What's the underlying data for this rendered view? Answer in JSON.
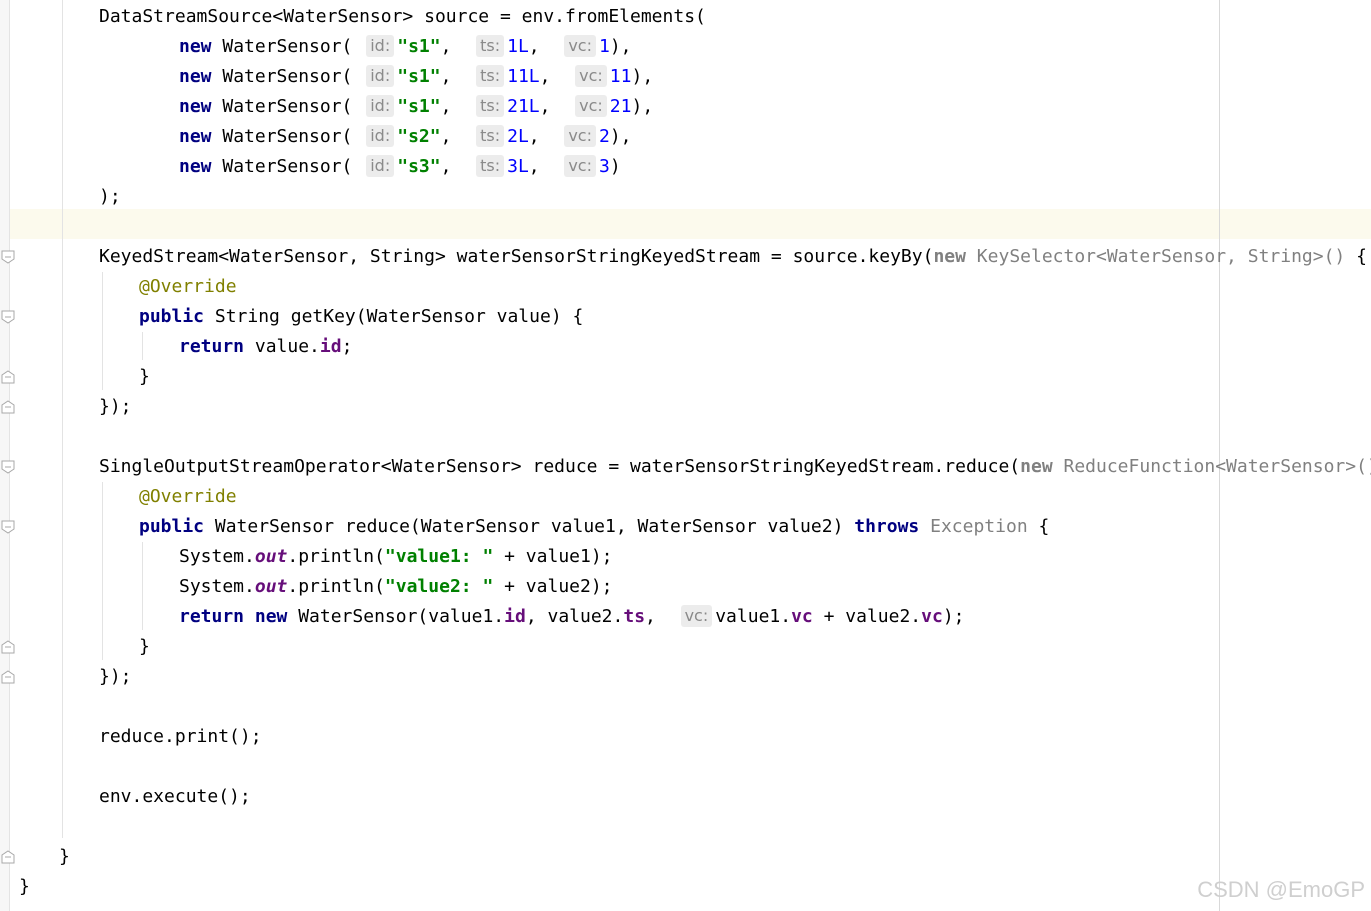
{
  "editor": {
    "lines": [
      {
        "indent": 99,
        "tokens": [
          [
            "t",
            "DataStreamSource<WaterSensor> source = env.fromElements("
          ]
        ]
      },
      {
        "indent": 179,
        "tokens": [
          [
            "kw",
            "new"
          ],
          [
            "t",
            " WaterSensor( "
          ],
          [
            "hint",
            "id:"
          ],
          [
            "str",
            "\"s1\""
          ],
          [
            "t",
            ",  "
          ],
          [
            "hint",
            "ts:"
          ],
          [
            "num",
            "1L"
          ],
          [
            "t",
            ",  "
          ],
          [
            "hint",
            "vc:"
          ],
          [
            "num",
            "1"
          ],
          [
            "t",
            "),"
          ]
        ]
      },
      {
        "indent": 179,
        "tokens": [
          [
            "kw",
            "new"
          ],
          [
            "t",
            " WaterSensor( "
          ],
          [
            "hint",
            "id:"
          ],
          [
            "str",
            "\"s1\""
          ],
          [
            "t",
            ",  "
          ],
          [
            "hint",
            "ts:"
          ],
          [
            "num",
            "11L"
          ],
          [
            "t",
            ",  "
          ],
          [
            "hint",
            "vc:"
          ],
          [
            "num",
            "11"
          ],
          [
            "t",
            "),"
          ]
        ]
      },
      {
        "indent": 179,
        "tokens": [
          [
            "kw",
            "new"
          ],
          [
            "t",
            " WaterSensor( "
          ],
          [
            "hint",
            "id:"
          ],
          [
            "str",
            "\"s1\""
          ],
          [
            "t",
            ",  "
          ],
          [
            "hint",
            "ts:"
          ],
          [
            "num",
            "21L"
          ],
          [
            "t",
            ",  "
          ],
          [
            "hint",
            "vc:"
          ],
          [
            "num",
            "21"
          ],
          [
            "t",
            "),"
          ]
        ]
      },
      {
        "indent": 179,
        "tokens": [
          [
            "kw",
            "new"
          ],
          [
            "t",
            " WaterSensor( "
          ],
          [
            "hint",
            "id:"
          ],
          [
            "str",
            "\"s2\""
          ],
          [
            "t",
            ",  "
          ],
          [
            "hint",
            "ts:"
          ],
          [
            "num",
            "2L"
          ],
          [
            "t",
            ",  "
          ],
          [
            "hint",
            "vc:"
          ],
          [
            "num",
            "2"
          ],
          [
            "t",
            "),"
          ]
        ]
      },
      {
        "indent": 179,
        "tokens": [
          [
            "kw",
            "new"
          ],
          [
            "t",
            " WaterSensor( "
          ],
          [
            "hint",
            "id:"
          ],
          [
            "str",
            "\"s3\""
          ],
          [
            "t",
            ",  "
          ],
          [
            "hint",
            "ts:"
          ],
          [
            "num",
            "3L"
          ],
          [
            "t",
            ",  "
          ],
          [
            "hint",
            "vc:"
          ],
          [
            "num",
            "3"
          ],
          [
            "t",
            ")"
          ]
        ]
      },
      {
        "indent": 99,
        "tokens": [
          [
            "t",
            ");"
          ]
        ]
      },
      {
        "indent": 99,
        "tokens": []
      },
      {
        "indent": 99,
        "tokens": [
          [
            "t",
            "KeyedStream<WaterSensor, String> waterSensorStringKeyedStream = source.keyBy("
          ],
          [
            "gkw",
            "new"
          ],
          [
            "gray",
            " KeySelector<WaterSensor, String>()"
          ],
          [
            "t",
            " {"
          ]
        ]
      },
      {
        "indent": 139,
        "tokens": [
          [
            "ann",
            "@Override"
          ]
        ]
      },
      {
        "indent": 139,
        "tokens": [
          [
            "kw",
            "public"
          ],
          [
            "t",
            " String getKey(WaterSensor value) {"
          ]
        ]
      },
      {
        "indent": 179,
        "tokens": [
          [
            "kw",
            "return"
          ],
          [
            "t",
            " value."
          ],
          [
            "fld",
            "id"
          ],
          [
            "t",
            ";"
          ]
        ]
      },
      {
        "indent": 139,
        "tokens": [
          [
            "t",
            "}"
          ]
        ]
      },
      {
        "indent": 99,
        "tokens": [
          [
            "t",
            "});"
          ]
        ]
      },
      {
        "indent": 99,
        "tokens": []
      },
      {
        "indent": 99,
        "tokens": [
          [
            "t",
            "SingleOutputStreamOperator<WaterSensor> reduce = waterSensorStringKeyedStream.reduce("
          ],
          [
            "gkw",
            "new"
          ],
          [
            "gray",
            " ReduceFunction<WaterSensor>()"
          ],
          [
            "t",
            " {"
          ]
        ]
      },
      {
        "indent": 139,
        "tokens": [
          [
            "ann",
            "@Override"
          ]
        ]
      },
      {
        "indent": 139,
        "tokens": [
          [
            "kw",
            "public"
          ],
          [
            "t",
            " WaterSensor reduce(WaterSensor value1, WaterSensor value2) "
          ],
          [
            "kw",
            "throws"
          ],
          [
            "gray",
            " Exception"
          ],
          [
            "t",
            " {"
          ]
        ]
      },
      {
        "indent": 179,
        "tokens": [
          [
            "t",
            "System."
          ],
          [
            "fi",
            "out"
          ],
          [
            "t",
            ".println("
          ],
          [
            "str",
            "\"value1: \""
          ],
          [
            "t",
            " + value1);"
          ]
        ]
      },
      {
        "indent": 179,
        "tokens": [
          [
            "t",
            "System."
          ],
          [
            "fi",
            "out"
          ],
          [
            "t",
            ".println("
          ],
          [
            "str",
            "\"value2: \""
          ],
          [
            "t",
            " + value2);"
          ]
        ]
      },
      {
        "indent": 179,
        "tokens": [
          [
            "kw",
            "return new"
          ],
          [
            "t",
            " WaterSensor(value1."
          ],
          [
            "fld",
            "id"
          ],
          [
            "t",
            ", value2."
          ],
          [
            "fld",
            "ts"
          ],
          [
            "t",
            ",  "
          ],
          [
            "hint",
            "vc:"
          ],
          [
            "t",
            "value1."
          ],
          [
            "fld",
            "vc"
          ],
          [
            "t",
            " + value2."
          ],
          [
            "fld",
            "vc"
          ],
          [
            "t",
            ");"
          ]
        ]
      },
      {
        "indent": 139,
        "tokens": [
          [
            "t",
            "}"
          ]
        ]
      },
      {
        "indent": 99,
        "tokens": [
          [
            "t",
            "});"
          ]
        ]
      },
      {
        "indent": 99,
        "tokens": []
      },
      {
        "indent": 99,
        "tokens": [
          [
            "t",
            "reduce.print();"
          ]
        ]
      },
      {
        "indent": 99,
        "tokens": []
      },
      {
        "indent": 99,
        "tokens": [
          [
            "t",
            "env.execute();"
          ]
        ]
      },
      {
        "indent": 99,
        "tokens": []
      },
      {
        "indent": 59,
        "tokens": [
          [
            "t",
            "}"
          ]
        ]
      },
      {
        "indent": 19,
        "tokens": [
          [
            "t",
            "}"
          ]
        ]
      }
    ]
  },
  "watermark": "CSDN @EmoGP"
}
